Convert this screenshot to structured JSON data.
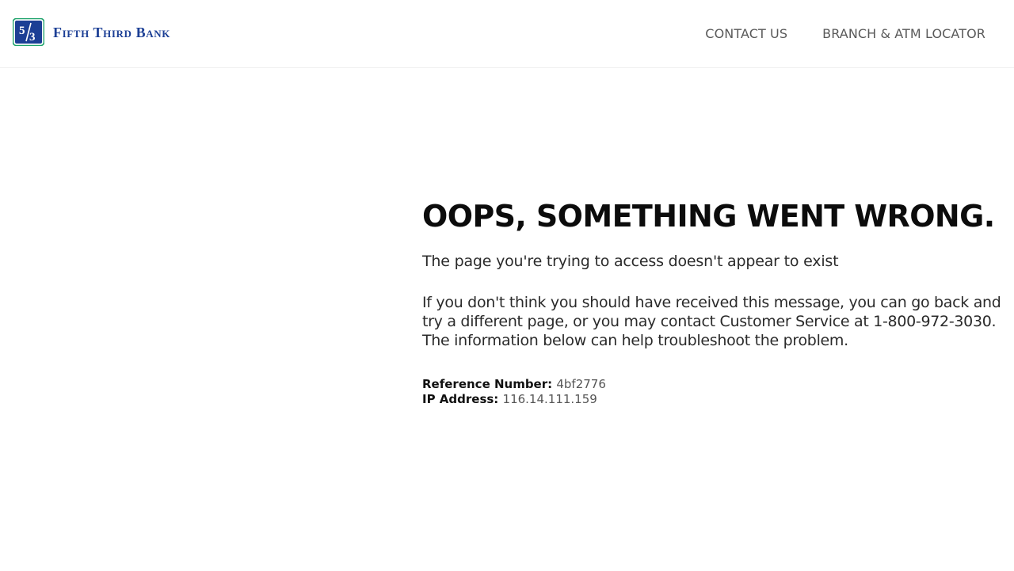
{
  "header": {
    "brand_name": "Fifth Third Bank",
    "brand_color": "#1c3f95",
    "logo_accent_color": "#1ea36b",
    "nav": {
      "contact_label": "CONTACT US",
      "locator_label": "BRANCH & ATM LOCATOR"
    }
  },
  "error": {
    "title": "OOPS, SOMETHING WENT WRONG.",
    "subtitle": "The page you're trying to access doesn't appear to exist",
    "message": "If you don't think you should have received this message, you can go back and try a different page, or you may contact Customer Service at 1-800-972-3030. The information below can help troubleshoot the problem.",
    "reference_label": "Reference Number:",
    "reference_value": "4bf2776",
    "ip_label": "IP Address:",
    "ip_value": "116.14.111.159"
  }
}
